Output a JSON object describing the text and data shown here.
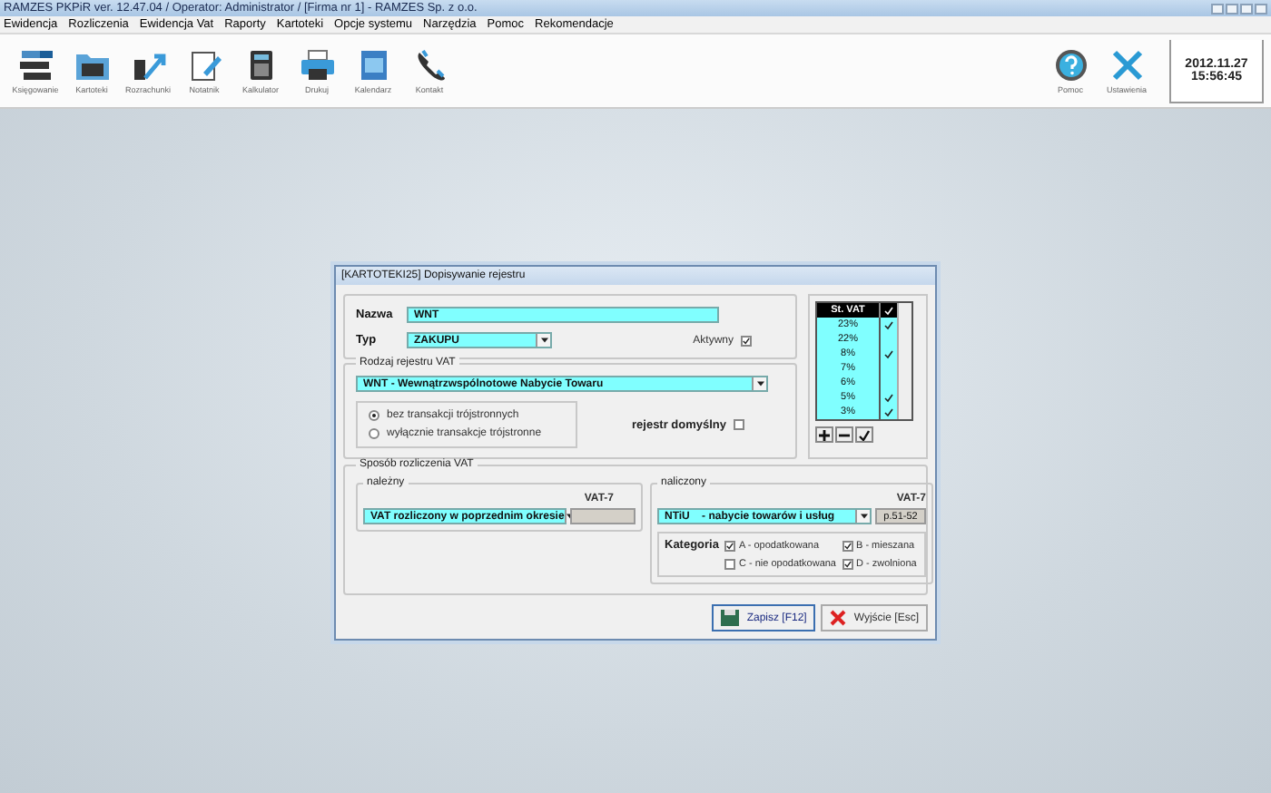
{
  "window": {
    "title": "RAMZES PKPiR ver. 12.47.04 /  Operator: Administrator /  [Firma nr 1] - RAMZES Sp. z o.o."
  },
  "menu": [
    "Ewidencja",
    "Rozliczenia",
    "Ewidencja Vat",
    "Raporty",
    "Kartoteki",
    "Opcje systemu",
    "Narzędzia",
    "Pomoc",
    "Rekomendacje"
  ],
  "toolbar": [
    {
      "label": "Księgowanie",
      "kind": "ledger"
    },
    {
      "label": "Kartoteki",
      "kind": "folder"
    },
    {
      "label": "Rozrachunki",
      "kind": "arrows"
    },
    {
      "label": "Notatnik",
      "kind": "note"
    },
    {
      "label": "Kalkulator",
      "kind": "calc"
    },
    {
      "label": "Drukuj",
      "kind": "print"
    },
    {
      "label": "Kalendarz",
      "kind": "calendar"
    },
    {
      "label": "Kontakt",
      "kind": "phone"
    }
  ],
  "toolbar_right": [
    {
      "label": "Pomoc",
      "kind": "help"
    },
    {
      "label": "Ustawienia",
      "kind": "tools"
    }
  ],
  "clock": {
    "date": "2012.11.27",
    "time": "15:56:45"
  },
  "dialog": {
    "title": "[KARTOTEKI25] Dopisywanie rejestru",
    "name": {
      "label": "Nazwa",
      "value": "WNT"
    },
    "type": {
      "label": "Typ",
      "value": "ZAKUPU"
    },
    "active": {
      "label": "Aktywny",
      "checked": true
    },
    "register_kind": {
      "legend": "Rodzaj rejestru VAT",
      "value": "WNT - Wewnątrzwspólnotowe Nabycie Towaru",
      "options": [
        {
          "label": "bez transakcji trójstronnych",
          "selected": true
        },
        {
          "label": "wyłącznie transakcje trójstronne",
          "selected": false
        }
      ],
      "default": {
        "label": "rejestr domyślny",
        "checked": false
      }
    },
    "rates": {
      "header": "St. VAT",
      "rows": [
        {
          "rate": "23%",
          "checked": true
        },
        {
          "rate": "22%",
          "checked": false
        },
        {
          "rate": "8%",
          "checked": true
        },
        {
          "rate": "7%",
          "checked": false
        },
        {
          "rate": "6%",
          "checked": false
        },
        {
          "rate": "5%",
          "checked": true
        },
        {
          "rate": "3%",
          "checked": true
        }
      ]
    },
    "settlement": {
      "legend": "Sposób rozliczenia VAT",
      "due": {
        "legend": "należny",
        "vat_label": "VAT-7",
        "value": "VAT rozliczony w poprzednim okresie"
      },
      "input": {
        "legend": "naliczony",
        "vat_label": "VAT-7",
        "value": "NTiU    - nabycie towarów i usług",
        "vat_value": "p.51-52",
        "category_label": "Kategoria",
        "categories": [
          {
            "label": "A - opodatkowana",
            "checked": true
          },
          {
            "label": "B - mieszana",
            "checked": true
          },
          {
            "label": "C - nie opodatkowana",
            "checked": false
          },
          {
            "label": "D - zwolniona",
            "checked": true
          }
        ]
      }
    },
    "buttons": [
      {
        "label": "Zapisz",
        "shortcut": "[F12]",
        "kind": "save"
      },
      {
        "label": "Wyjście",
        "shortcut": "[Esc]",
        "kind": "exit"
      }
    ]
  }
}
